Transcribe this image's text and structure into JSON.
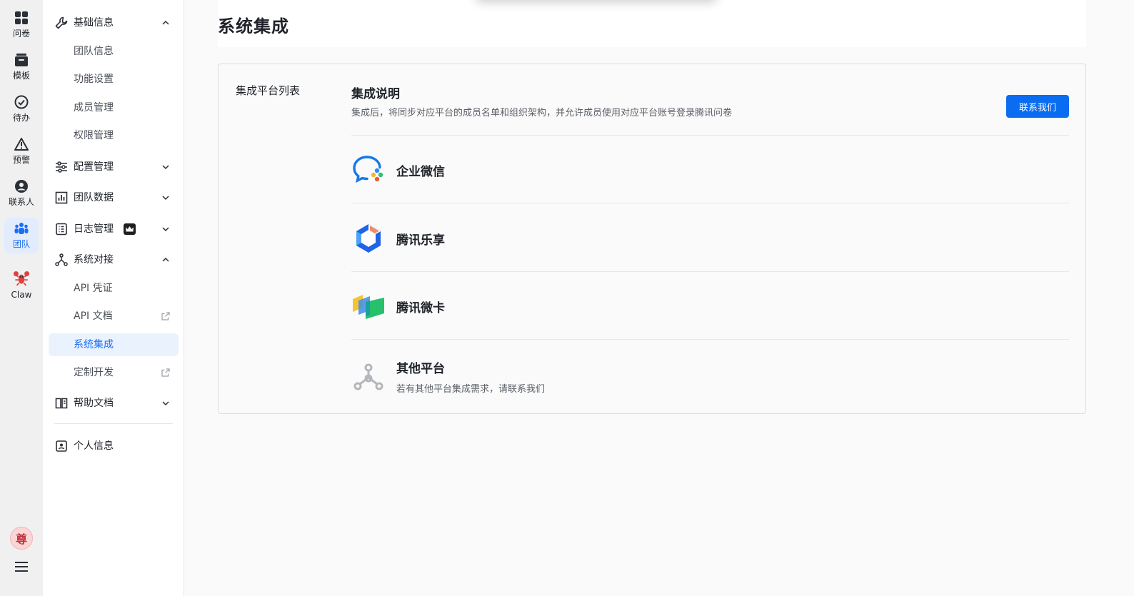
{
  "rail": {
    "items": [
      {
        "label": "问卷",
        "icon": "grid-icon"
      },
      {
        "label": "模板",
        "icon": "template-icon"
      },
      {
        "label": "待办",
        "icon": "check-circle-icon"
      },
      {
        "label": "预警",
        "icon": "warning-icon"
      },
      {
        "label": "联系人",
        "icon": "contact-icon"
      },
      {
        "label": "团队",
        "icon": "team-icon"
      },
      {
        "label": "Claw",
        "icon": "lobster-icon"
      }
    ],
    "avatar_text": "尊"
  },
  "sidebar": {
    "groups": [
      {
        "label": "基础信息",
        "icon": "wrench-icon",
        "expanded": true
      },
      {
        "label": "配置管理",
        "icon": "sliders-icon",
        "expanded": false
      },
      {
        "label": "团队数据",
        "icon": "chart-icon",
        "expanded": false
      },
      {
        "label": "日志管理",
        "icon": "log-icon",
        "expanded": false
      },
      {
        "label": "系统对接",
        "icon": "nodes-icon",
        "expanded": true
      },
      {
        "label": "帮助文档",
        "icon": "book-icon",
        "expanded": false
      }
    ],
    "basic_items": [
      "团队信息",
      "功能设置",
      "成员管理",
      "权限管理"
    ],
    "integration_items": [
      "API 凭证",
      "API 文档",
      "系统集成",
      "定制开发"
    ],
    "personal": "个人信息"
  },
  "main": {
    "title": "系统集成",
    "list_label": "集成平台列表",
    "intro_title": "集成说明",
    "intro_desc": "集成后，将同步对应平台的成员名单和组织架构，并允许成员使用对应平台账号登录腾讯问卷",
    "contact_button": "联系我们",
    "platforms": [
      {
        "name": "企业微信",
        "logo": "wecom-logo-icon"
      },
      {
        "name": "腾讯乐享",
        "logo": "lexiang-logo-icon"
      },
      {
        "name": "腾讯微卡",
        "logo": "weika-logo-icon"
      },
      {
        "name": "其他平台",
        "desc": "若有其他平台集成需求，请联系我们",
        "logo": "other-platform-icon"
      }
    ]
  },
  "colors": {
    "accent": "#0a6cf0",
    "active_bg": "#eaf2fe"
  }
}
